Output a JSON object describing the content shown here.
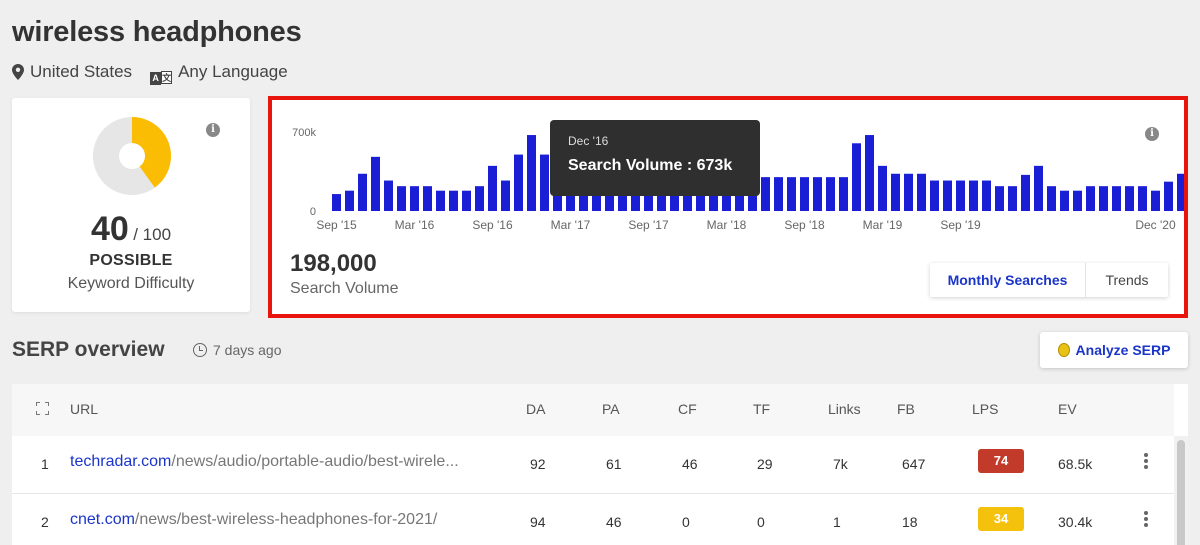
{
  "keyword": "wireless headphones",
  "location": "United States",
  "language": "Any Language",
  "difficulty": {
    "score": "40",
    "max": "/ 100",
    "label": "POSSIBLE",
    "subtitle": "Keyword Difficulty",
    "value": 0.4,
    "color": "#fbbc04"
  },
  "info_glyph": "i",
  "volume": {
    "value": "198,000",
    "label": "Search Volume",
    "tabs": [
      {
        "label": "Monthly Searches",
        "active": true
      },
      {
        "label": "Trends",
        "active": false
      }
    ]
  },
  "tooltip": {
    "date": "Dec '16",
    "text": "Search Volume : 673k"
  },
  "chart_data": {
    "type": "bar",
    "bar_color": "#1a1fd6",
    "y_ticks": [
      "700k",
      "0"
    ],
    "y_tick_values": [
      700000,
      0
    ],
    "ylim": [
      0,
      700000
    ],
    "x_tick_labels": [
      "Sep '15",
      "Mar '16",
      "Sep '16",
      "Mar '17",
      "Sep '17",
      "Mar '18",
      "Sep '18",
      "Mar '19",
      "Sep '19",
      "Dec '20"
    ],
    "x_tick_indices": [
      0,
      6,
      12,
      18,
      24,
      30,
      36,
      42,
      48,
      63
    ],
    "highlighted_index": 15,
    "values": [
      150000,
      180000,
      330000,
      480000,
      270000,
      220000,
      220000,
      220000,
      180000,
      180000,
      180000,
      220000,
      400000,
      270000,
      500000,
      673000,
      500000,
      330000,
      220000,
      180000,
      180000,
      180000,
      180000,
      180000,
      180000,
      180000,
      180000,
      180000,
      180000,
      180000,
      300000,
      300000,
      300000,
      300000,
      300000,
      300000,
      300000,
      300000,
      300000,
      300000,
      600000,
      673000,
      400000,
      330000,
      330000,
      330000,
      270000,
      270000,
      270000,
      270000,
      270000,
      220000,
      220000,
      320000,
      400000,
      220000,
      180000,
      180000,
      220000,
      220000,
      220000,
      220000,
      220000,
      180000,
      260000,
      330000
    ]
  },
  "serp": {
    "title": "SERP overview",
    "ago": "7 days ago",
    "analyze_label": "Analyze SERP",
    "columns": [
      "URL",
      "DA",
      "PA",
      "CF",
      "TF",
      "Links",
      "FB",
      "LPS",
      "EV"
    ],
    "rows": [
      {
        "rank": "1",
        "domain": "techradar.com",
        "path": "/news/audio/portable-audio/best-wirele...",
        "da": "92",
        "pa": "61",
        "cf": "46",
        "tf": "29",
        "links": "7k",
        "fb": "647",
        "lps": "74",
        "lps_color": "#c13a2a",
        "ev": "68.5k"
      },
      {
        "rank": "2",
        "domain": "cnet.com",
        "path": "/news/best-wireless-headphones-for-2021/",
        "da": "94",
        "pa": "46",
        "cf": "0",
        "tf": "0",
        "links": "1",
        "fb": "18",
        "lps": "34",
        "lps_color": "#f4c20d",
        "ev": "30.4k"
      }
    ]
  }
}
